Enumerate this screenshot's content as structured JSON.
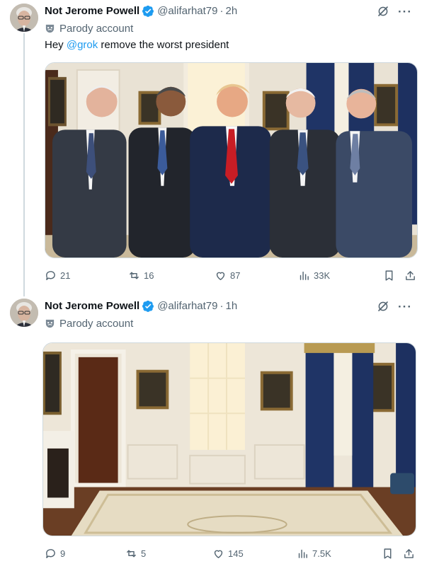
{
  "tweets": [
    {
      "author_name": "Not Jerome Powell",
      "handle": "@alifarhat79",
      "time": "2h",
      "parody_label": "Parody account",
      "text_prefix": "Hey ",
      "mention": "@grok",
      "text_suffix": " remove the worst president",
      "media_description": "five men in suits in oval office",
      "replies": "21",
      "reposts": "16",
      "likes": "87",
      "views": "33K"
    },
    {
      "author_name": "Not Jerome Powell",
      "handle": "@alifarhat79",
      "time": "1h",
      "parody_label": "Parody account",
      "media_description": "empty oval office",
      "replies": "9",
      "reposts": "5",
      "likes": "145",
      "views": "7.5K"
    }
  ],
  "ui": {
    "dot_separator": "·",
    "more_icon": "···",
    "icons": [
      "verified-badge-icon",
      "grok-icon",
      "more-icon",
      "parody-mask-icon",
      "reply-icon",
      "repost-icon",
      "like-icon",
      "views-icon",
      "bookmark-icon",
      "share-icon"
    ],
    "colors": {
      "accent": "#1d9bf0",
      "secondary_text": "#536471",
      "divider": "#cfd9de"
    }
  }
}
